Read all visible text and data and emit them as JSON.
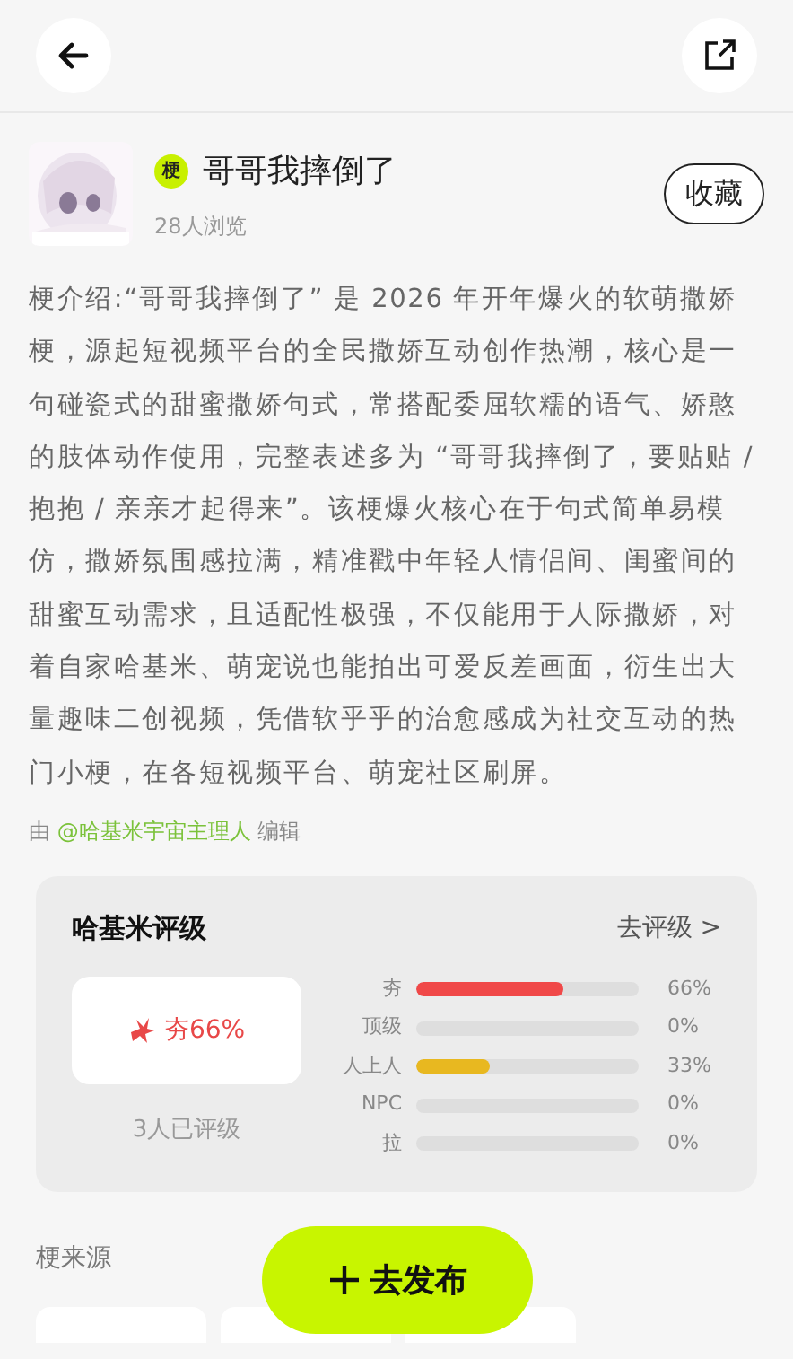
{
  "header": {
    "title_tag": "梗",
    "title": "哥哥我摔倒了",
    "views": "28人浏览",
    "collect_button": "收藏"
  },
  "description": "梗介绍:“哥哥我摔倒了” 是 2026 年开年爆火的软萌撒娇梗，源起短视频平台的全民撒娇互动创作热潮，核心是一句碰瓷式的甜蜜撒娇句式，常搭配委屈软糯的语气、娇憨的肢体动作使用，完整表述多为 “哥哥我摔倒了，要贴贴 / 抱抱 / 亲亲才起得来”。该梗爆火核心在于句式简单易模仿，撒娇氛围感拉满，精准戳中年轻人情侣间、闺蜜间的甜蜜互动需求，且适配性极强，不仅能用于人际撒娇，对着自家哈基米、萌宠说也能拍出可爱反差画面，衍生出大量趣味二创视频，凭借软乎乎的治愈感成为社交互动的热门小梗，在各短视频平台、萌宠社区刷屏。",
  "editor": {
    "prefix": "由",
    "name": "@哈基米宇宙主理人",
    "suffix": "编辑"
  },
  "rating": {
    "title": "哈基米评级",
    "action": "去评级 >",
    "top_result": "夯66%",
    "rated_count": "3人已评级",
    "levels": [
      {
        "label": "夯",
        "level": 0.66,
        "reading": "66%",
        "color": "#f04848"
      },
      {
        "label": "顶级",
        "level": 0,
        "reading": "0%"
      },
      {
        "label": "人上人",
        "level": 0.33,
        "reading": "33%",
        "color": "#e8b820"
      },
      {
        "label": "NPC",
        "level": 0,
        "reading": "0%"
      },
      {
        "label": "拉",
        "level": 0,
        "reading": "0%"
      }
    ]
  },
  "source": {
    "title": "梗来源"
  },
  "publish_button": "去发布"
}
